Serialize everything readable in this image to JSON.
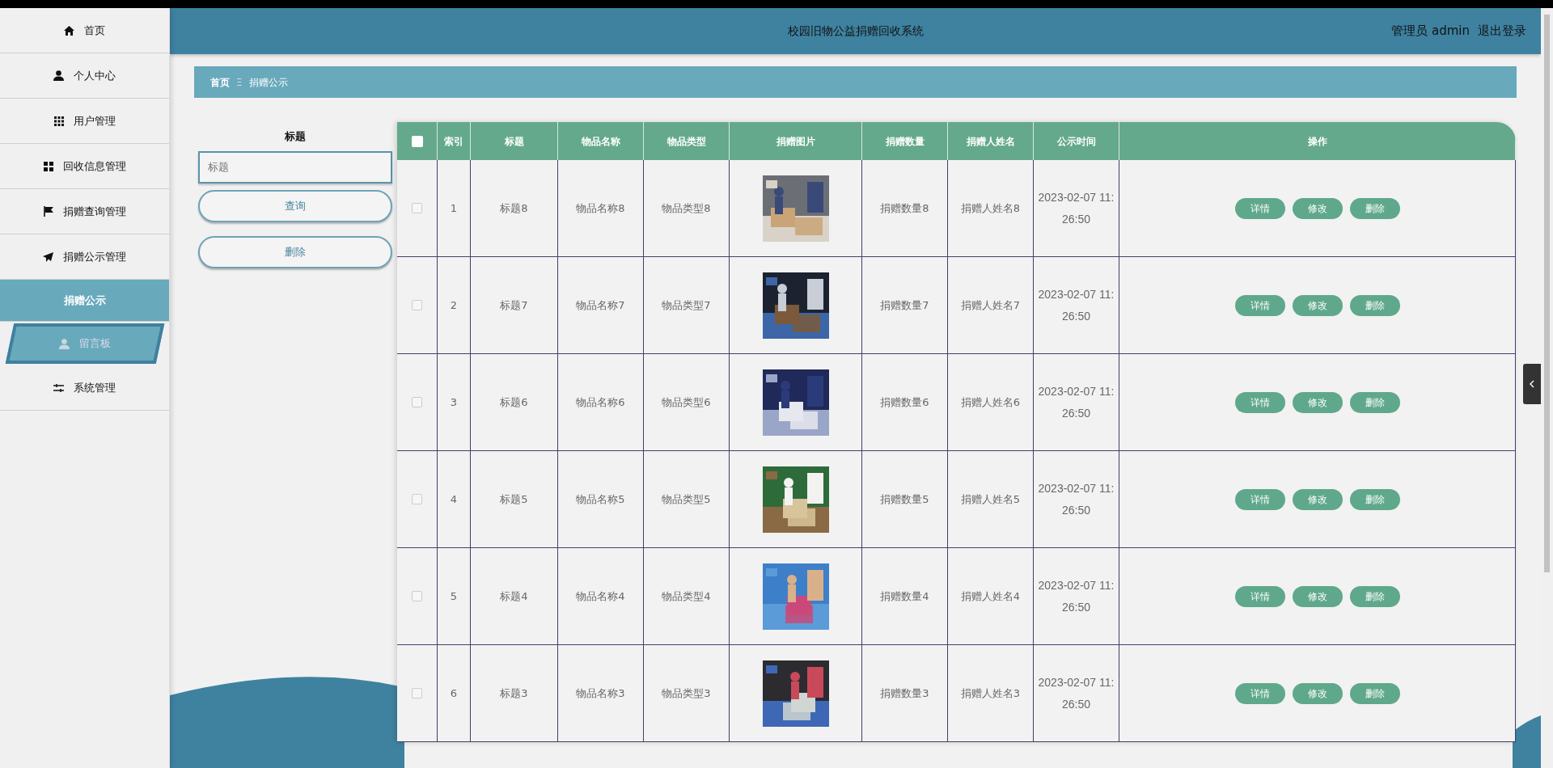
{
  "sidebar": {
    "items": [
      {
        "label": "首页",
        "kind": "main",
        "selected": false,
        "hovered": false
      },
      {
        "label": "个人中心",
        "kind": "main",
        "selected": false,
        "hovered": false
      },
      {
        "label": "用户管理",
        "kind": "main",
        "selected": false,
        "hovered": false
      },
      {
        "label": "回收信息管理",
        "kind": "main",
        "selected": false,
        "hovered": false
      },
      {
        "label": "捐赠查询管理",
        "kind": "main",
        "selected": false,
        "hovered": false
      },
      {
        "label": "捐赠公示管理",
        "kind": "main",
        "selected": false,
        "hovered": false
      },
      {
        "label": "捐赠公示",
        "kind": "sub",
        "selected": true,
        "hovered": false
      },
      {
        "label": "留言板",
        "kind": "main",
        "selected": false,
        "hovered": true
      },
      {
        "label": "系统管理",
        "kind": "main",
        "selected": false,
        "hovered": false
      }
    ]
  },
  "header": {
    "title": "校园旧物公益捐赠回收系统",
    "user": "管理员 admin",
    "logout": "退出登录"
  },
  "breadcrumb": {
    "home": "首页",
    "separator": "Ξ",
    "current": "捐赠公示"
  },
  "search": {
    "label": "标题",
    "placeholder": "标题",
    "buttons": [
      "查询",
      "删除"
    ]
  },
  "table": {
    "all_checked": false,
    "columns": [
      "索引",
      "标题",
      "物品名称",
      "物品类型",
      "捐赠图片",
      "捐赠数量",
      "捐赠人姓名",
      "公示时间",
      "操作"
    ],
    "rows": [
      {
        "checked": false,
        "index": "1",
        "title": "标题8",
        "name": "物品名称8",
        "type": "物品类型8",
        "quantity": "捐赠数量8",
        "donor": "捐赠人姓名8",
        "time": "2023-02-07 11:26:50",
        "actions": [
          "详情",
          "修改",
          "删除"
        ]
      },
      {
        "checked": false,
        "index": "2",
        "title": "标题7",
        "name": "物品名称7",
        "type": "物品类型7",
        "quantity": "捐赠数量7",
        "donor": "捐赠人姓名7",
        "time": "2023-02-07 11:26:50",
        "actions": [
          "详情",
          "修改",
          "删除"
        ]
      },
      {
        "checked": false,
        "index": "3",
        "title": "标题6",
        "name": "物品名称6",
        "type": "物品类型6",
        "quantity": "捐赠数量6",
        "donor": "捐赠人姓名6",
        "time": "2023-02-07 11:26:50",
        "actions": [
          "详情",
          "修改",
          "删除"
        ]
      },
      {
        "checked": false,
        "index": "4",
        "title": "标题5",
        "name": "物品名称5",
        "type": "物品类型5",
        "quantity": "捐赠数量5",
        "donor": "捐赠人姓名5",
        "time": "2023-02-07 11:26:50",
        "actions": [
          "详情",
          "修改",
          "删除"
        ]
      },
      {
        "checked": false,
        "index": "5",
        "title": "标题4",
        "name": "物品名称4",
        "type": "物品类型4",
        "quantity": "捐赠数量4",
        "donor": "捐赠人姓名4",
        "time": "2023-02-07 11:26:50",
        "actions": [
          "详情",
          "修改",
          "删除"
        ]
      },
      {
        "checked": false,
        "index": "6",
        "title": "标题3",
        "name": "物品名称3",
        "type": "物品类型3",
        "quantity": "捐赠数量3",
        "donor": "捐赠人姓名3",
        "time": "2023-02-07 11:26:50",
        "actions": [
          "详情",
          "修改",
          "删除"
        ]
      }
    ]
  }
}
